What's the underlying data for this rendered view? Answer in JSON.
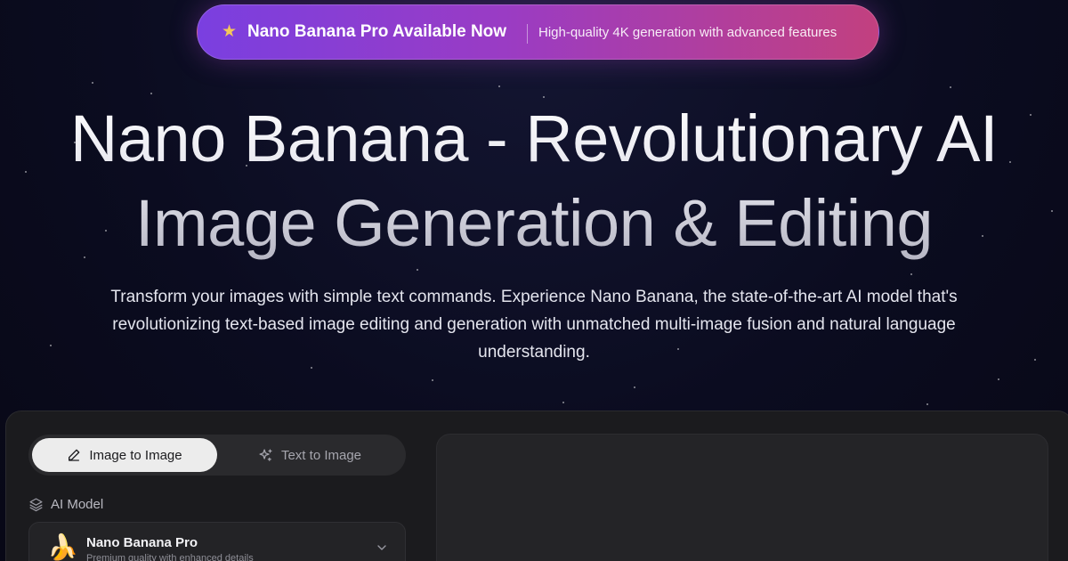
{
  "announcement": {
    "title": "Nano Banana Pro Available Now",
    "subtitle": "High-quality 4K generation with advanced features",
    "icon": "star-icon",
    "star_color": "#f4c75a",
    "gradient_start": "#7a3fe0",
    "gradient_end": "#c2407f"
  },
  "hero": {
    "title_line1": "Nano Banana - Revolutionary AI",
    "title_line2": "Image Generation & Editing",
    "description": "Transform your images with simple text commands. Experience Nano Banana, the state-of-the-art AI model that's revolutionizing text-based image editing and generation with unmatched multi-image fusion and natural language understanding."
  },
  "generator": {
    "tabs": [
      {
        "label": "Image to Image",
        "icon": "pencil-icon",
        "active": true
      },
      {
        "label": "Text to Image",
        "icon": "sparkles-icon",
        "active": false
      }
    ],
    "model_section_label": "AI Model",
    "model_section_icon": "layers-icon",
    "selected_model": {
      "name": "Nano Banana Pro",
      "description": "Premium quality with enhanced details",
      "icon": "banana-emoji"
    }
  }
}
